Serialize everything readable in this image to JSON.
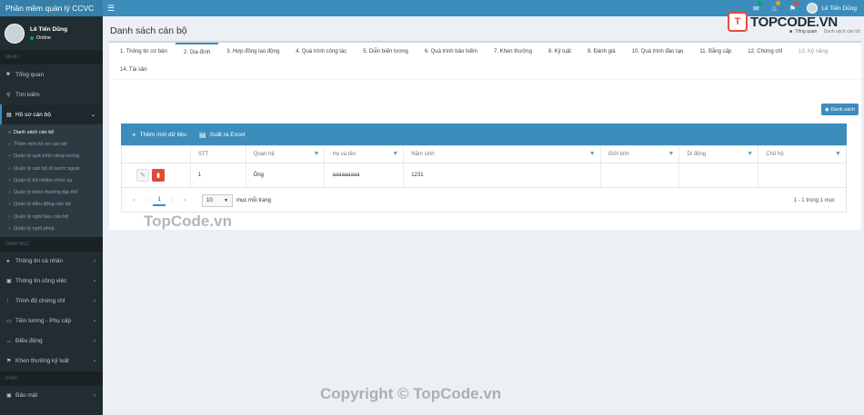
{
  "app": {
    "title": "Phần mềm quản lý CCVC"
  },
  "header": {
    "menu_icon": "hamburger-icon",
    "user_name": "Lê Tiến Dũng",
    "badges": {
      "mail_color": "#00a65a",
      "bell_color": "#f39c12",
      "flag_color": "#dd4b39"
    }
  },
  "brand": {
    "mark": "T",
    "text": "TOPCODE.VN"
  },
  "sidebar": {
    "user_name": "Lê Tiến Dũng",
    "status": "Online",
    "section_menu": "MENU",
    "items_top": [
      {
        "label": "Tổng quan",
        "icon": "dashboard-icon"
      },
      {
        "label": "Tìm kiếm",
        "icon": "search-icon"
      },
      {
        "label": "Hồ sơ cán bộ",
        "icon": "folder-icon"
      }
    ],
    "subitems": [
      "Danh sách cán bộ",
      "Thêm mới hồ sơ cán bộ",
      "Quản lý quá trình nâng lương",
      "Quản lý cán bộ đi nước ngoài",
      "Quản lý bổ nhiệm chức vụ",
      "Quản lý khen thưởng tập thể",
      "Quản lý điều động cán bộ",
      "Quản lý nghỉ hưu cán bộ",
      "Quản lý nghỉ phép"
    ],
    "section_catalog": "DANH MỤC",
    "items_catalog": [
      {
        "label": "Thông tin cá nhân",
        "icon": "user-icon"
      },
      {
        "label": "Thông tin công việc",
        "icon": "briefcase-icon"
      },
      {
        "label": "Trình độ chứng chỉ",
        "icon": "certificate-icon"
      },
      {
        "label": "Tiền lương - Phụ cấp",
        "icon": "money-icon"
      },
      {
        "label": "Điều động",
        "icon": "arrows-icon"
      },
      {
        "label": "Khen thưởng kỷ luật",
        "icon": "award-icon"
      }
    ],
    "section_other": "KHÁC",
    "items_other": [
      {
        "label": "Bảo mật",
        "icon": "lock-icon"
      }
    ]
  },
  "page": {
    "title": "Danh sách cán bộ",
    "breadcrumb_home": "Tổng quan",
    "breadcrumb_current": "Danh sách cán bộ"
  },
  "tabs": [
    "1. Thông tin cơ bản",
    "2. Gia đình",
    "3. Hợp đồng lao động",
    "4. Quá trình công tác",
    "5. Diễn biến lương",
    "6. Quá trình bảo hiểm",
    "7. Khen thưởng",
    "8. Kỷ luật",
    "9. Đánh giá",
    "10. Quá trình đào tạo",
    "11. Bằng cấp",
    "12. Chứng chỉ",
    "13. Kỹ năng",
    "14. Tài sản"
  ],
  "list_button": "Danh sách",
  "toolbar": {
    "add_label": "Thêm mới dữ liệu",
    "export_label": "Xuất ra Excel"
  },
  "table": {
    "columns": [
      "STT",
      "Quan hệ",
      "Họ và tên",
      "Năm sinh",
      "Giới tính",
      "Di động",
      "Chủ hộ"
    ],
    "rows": [
      {
        "stt": "1",
        "quan_he": "Ông",
        "ho_ten": "aaaaaaaaa",
        "nam_sinh": "1231",
        "gioi_tinh": "",
        "di_dong": "",
        "chu_ho": ""
      }
    ]
  },
  "pager": {
    "page": "1",
    "page_size": "10",
    "per_page_label": "mục mỗi trang",
    "info": "1 - 1 trong 1 mục"
  },
  "watermarks": {
    "top": "TopCode.vn",
    "bottom": "Copyright © TopCode.vn"
  }
}
